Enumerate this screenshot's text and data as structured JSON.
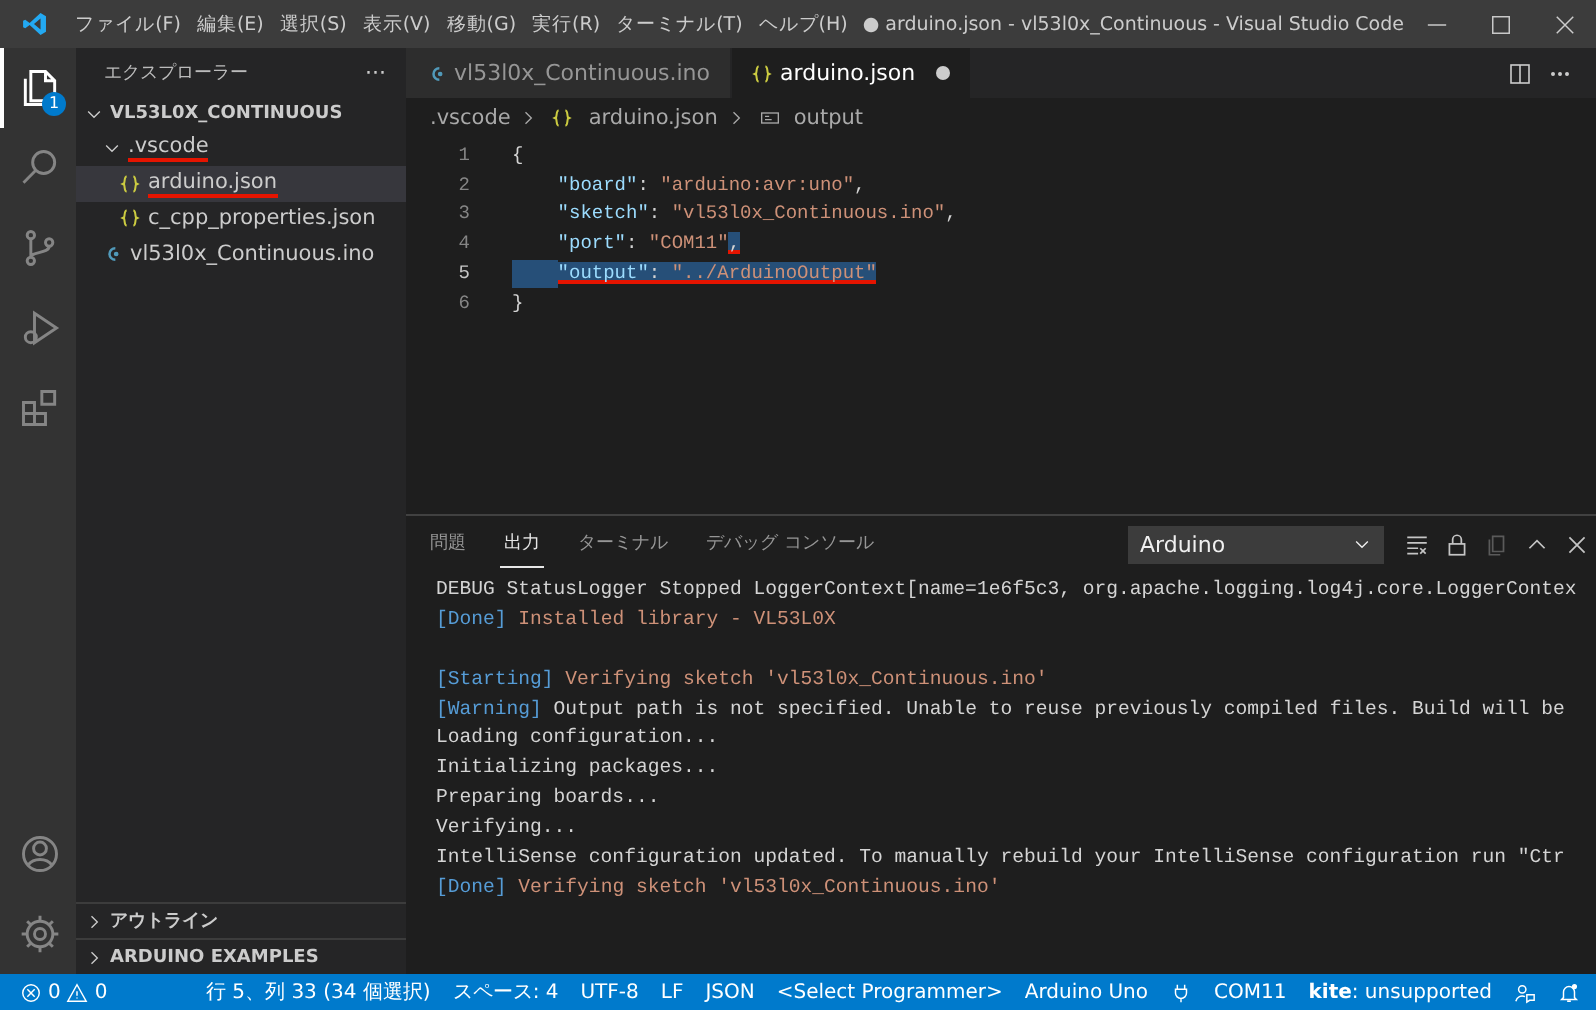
{
  "window": {
    "title": "● arduino.json - vl53l0x_Continuous - Visual Studio Code"
  },
  "menu": [
    "ファイル(F)",
    "編集(E)",
    "選択(S)",
    "表示(V)",
    "移動(G)",
    "実行(R)",
    "ターミナル(T)",
    "ヘルプ(H)"
  ],
  "activity_bar": {
    "items": [
      {
        "kind": "files",
        "selected": true,
        "badge": "1"
      },
      {
        "kind": "search",
        "selected": false
      },
      {
        "kind": "source-control",
        "selected": false
      },
      {
        "kind": "run",
        "selected": false
      },
      {
        "kind": "extensions",
        "selected": false
      }
    ],
    "bottom": [
      {
        "kind": "account"
      },
      {
        "kind": "settings"
      }
    ]
  },
  "sidebar": {
    "title": "エクスプローラー",
    "more": "···",
    "tree": [
      {
        "label": "VL53L0X_CONTINUOUS",
        "kind": "root",
        "expanded": true,
        "children": [
          {
            "label": ".vscode",
            "kind": "folder",
            "expanded": true,
            "underlined": true,
            "selected": false,
            "children": [
              {
                "label": "arduino.json",
                "kind": "json",
                "selected": true,
                "underlined": true
              },
              {
                "label": "c_cpp_properties.json",
                "kind": "json",
                "selected": false,
                "underlined": false
              }
            ]
          },
          {
            "label": "vl53l0x_Continuous.ino",
            "kind": "ino",
            "selected": false,
            "underlined": false
          }
        ]
      }
    ],
    "sections": [
      {
        "label": "アウトライン",
        "expanded": false
      },
      {
        "label": "ARDUINO EXAMPLES",
        "expanded": false
      }
    ]
  },
  "editor": {
    "tabs": [
      {
        "label": "vl53l0x_Continuous.ino",
        "kind": "ino",
        "selected": false,
        "modified": false
      },
      {
        "label": "arduino.json",
        "kind": "json",
        "selected": true,
        "modified": true
      }
    ],
    "breadcrumb": [
      {
        "label": ".vscode",
        "kind": "folder"
      },
      {
        "label": "arduino.json",
        "kind": "json"
      },
      {
        "label": "output",
        "kind": "property"
      }
    ],
    "lines": [
      {
        "number": "1",
        "current": false,
        "tokens": [
          {
            "text": "{",
            "kind": "punct",
            "selected": false,
            "underlined": false
          }
        ]
      },
      {
        "number": "2",
        "current": false,
        "tokens": [
          {
            "kind": "whitespace",
            "selected": false,
            "underlined": false
          },
          {
            "text": "\"board\"",
            "kind": "key",
            "selected": false,
            "underlined": false
          },
          {
            "text": ": ",
            "kind": "punct",
            "selected": false,
            "underlined": false
          },
          {
            "text": "\"arduino:avr:uno\"",
            "kind": "string",
            "selected": false,
            "underlined": false
          },
          {
            "text": ",",
            "kind": "punct",
            "selected": false,
            "underlined": false
          }
        ]
      },
      {
        "number": "3",
        "current": false,
        "tokens": [
          {
            "kind": "whitespace",
            "selected": false,
            "underlined": false
          },
          {
            "text": "\"sketch\"",
            "kind": "key",
            "selected": false,
            "underlined": false
          },
          {
            "text": ": ",
            "kind": "punct",
            "selected": false,
            "underlined": false
          },
          {
            "text": "\"vl53l0x_Continuous.ino\"",
            "kind": "string",
            "selected": false,
            "underlined": false
          },
          {
            "text": ",",
            "kind": "punct",
            "selected": false,
            "underlined": false
          }
        ]
      },
      {
        "number": "4",
        "current": false,
        "tokens": [
          {
            "kind": "whitespace",
            "selected": false,
            "underlined": false
          },
          {
            "text": "\"port\"",
            "kind": "key",
            "selected": false,
            "underlined": false
          },
          {
            "text": ": ",
            "kind": "punct",
            "selected": false,
            "underlined": false
          },
          {
            "text": "\"COM11\"",
            "kind": "string",
            "selected": false,
            "underlined": false
          },
          {
            "text": ",",
            "kind": "punct",
            "selected": true,
            "underlined": true
          }
        ]
      },
      {
        "number": "5",
        "current": true,
        "tokens": [
          {
            "kind": "whitespace",
            "selected": true,
            "underlined": false
          },
          {
            "text": "\"output\"",
            "kind": "key",
            "selected": true,
            "underlined": true
          },
          {
            "text": ": ",
            "kind": "punct",
            "selected": true,
            "underlined": true
          },
          {
            "text": "\"../ArduinoOutput\"",
            "kind": "string",
            "selected": true,
            "underlined": true
          }
        ]
      },
      {
        "number": "6",
        "current": false,
        "tokens": [
          {
            "text": "}",
            "kind": "punct",
            "selected": false,
            "underlined": false
          }
        ]
      }
    ]
  },
  "panel": {
    "tabs": [
      {
        "label": "問題",
        "selected": false
      },
      {
        "label": "出力",
        "selected": true
      },
      {
        "label": "ターミナル",
        "selected": false
      },
      {
        "label": "デバッグ コンソール",
        "selected": false
      }
    ],
    "channel": "Arduino",
    "actions": [
      {
        "kind": "clear",
        "disabled": false
      },
      {
        "kind": "lock",
        "disabled": false
      },
      {
        "kind": "copy",
        "disabled": true
      },
      {
        "kind": "maximize",
        "disabled": false
      },
      {
        "kind": "close",
        "disabled": false
      }
    ],
    "output": [
      [
        {
          "text": "DEBUG StatusLogger Stopped LoggerContext[name=1e6f5c3, org.apache.logging.log4j.core.LoggerContex",
          "kind": "plain"
        }
      ],
      [
        {
          "text": "[Done]",
          "kind": "tag"
        },
        {
          "text": " Installed library - VL53L0X",
          "kind": "accent"
        }
      ],
      [
        {
          "kind": "blank"
        }
      ],
      [
        {
          "text": "[Starting]",
          "kind": "tag"
        },
        {
          "text": " Verifying sketch 'vl53l0x_Continuous.ino'",
          "kind": "accent"
        }
      ],
      [
        {
          "text": "[Warning]",
          "kind": "tag"
        },
        {
          "text": " Output path is not specified. Unable to reuse previously compiled files. Build will be",
          "kind": "plain"
        }
      ],
      [
        {
          "text": "Loading configuration...",
          "kind": "plain"
        }
      ],
      [
        {
          "text": "Initializing packages...",
          "kind": "plain"
        }
      ],
      [
        {
          "text": "Preparing boards...",
          "kind": "plain"
        }
      ],
      [
        {
          "text": "Verifying...",
          "kind": "plain"
        }
      ],
      [
        {
          "text": "IntelliSense configuration updated. To manually rebuild your IntelliSense configuration run \"Ctr",
          "kind": "plain"
        }
      ],
      [
        {
          "text": "[Done]",
          "kind": "tag"
        },
        {
          "text": " Verifying sketch 'vl53l0x_Continuous.ino'",
          "kind": "accent"
        }
      ]
    ]
  },
  "status_bar": {
    "errors": "0",
    "warnings": "0",
    "items": [
      {
        "kind": "text",
        "text": "行 5、列 33 (34 個選択)"
      },
      {
        "kind": "text",
        "text": "スペース: 4"
      },
      {
        "kind": "text",
        "text": "UTF-8"
      },
      {
        "kind": "text",
        "text": "LF"
      },
      {
        "kind": "text",
        "text": "JSON"
      },
      {
        "kind": "text",
        "text": "<Select Programmer>"
      },
      {
        "kind": "text",
        "text": "Arduino Uno"
      },
      {
        "kind": "plug"
      },
      {
        "kind": "text",
        "text": "COM11"
      },
      {
        "kind": "text",
        "text": "**kite**: unsupported"
      },
      {
        "kind": "feedback"
      },
      {
        "kind": "bell"
      }
    ]
  }
}
